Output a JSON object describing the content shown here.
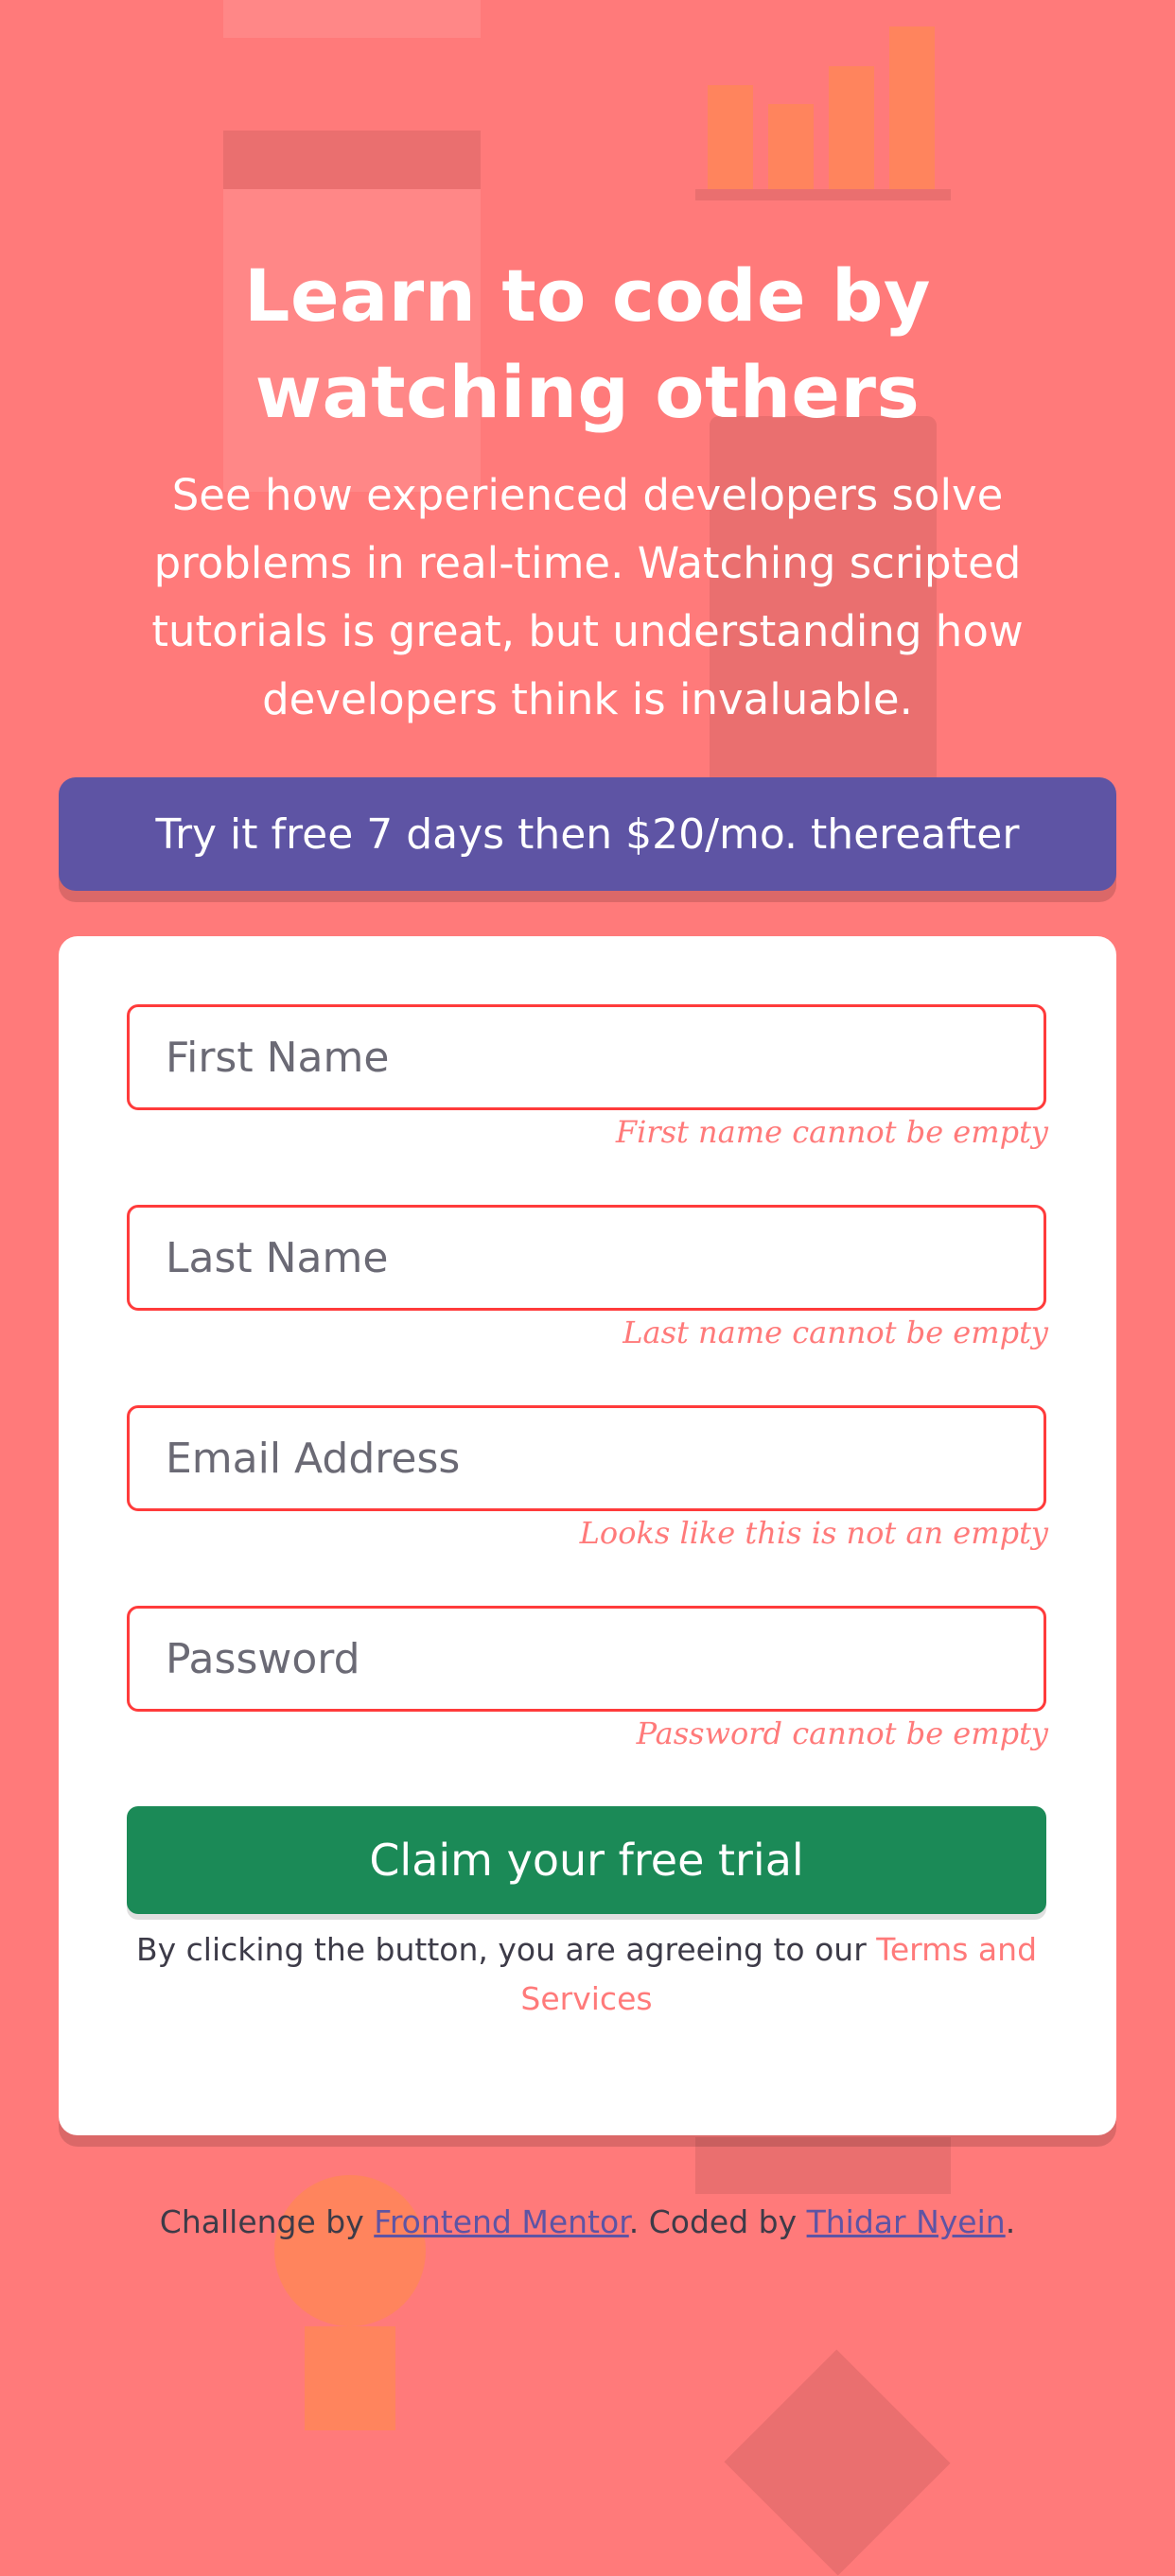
{
  "hero": {
    "title_line1": "Learn to code by",
    "title_line2": "watching others",
    "description": "See how experienced developers solve problems in real-time. Watching scripted tutorials is great, but understanding how developers think is invaluable."
  },
  "offer": {
    "bold_text": "Try it free 7 days",
    "rest_text": " then $20/mo. thereafter"
  },
  "form": {
    "fields": [
      {
        "placeholder": "First Name",
        "value": "",
        "error": "First name cannot be empty"
      },
      {
        "placeholder": "Last Name",
        "value": "",
        "error": "Last name cannot be empty"
      },
      {
        "placeholder": "Email Address",
        "value": "",
        "error": "Looks like this is not an empty"
      },
      {
        "placeholder": "Password",
        "value": "",
        "error": "Password cannot be empty"
      }
    ],
    "submit_label": "Claim your free trial",
    "terms_prefix": "By clicking the button, you are agreeing to our ",
    "terms_link": "Terms and Services"
  },
  "footer": {
    "prefix": "Challenge by ",
    "link1": "Frontend Mentor",
    "middle": ". Coded by ",
    "link2": "Thidar Nyein",
    "suffix": "."
  },
  "colors": {
    "background": "#ff7a7a",
    "banner": "#5e54a4",
    "button": "#1b8a57",
    "error": "#ff3b3b"
  }
}
